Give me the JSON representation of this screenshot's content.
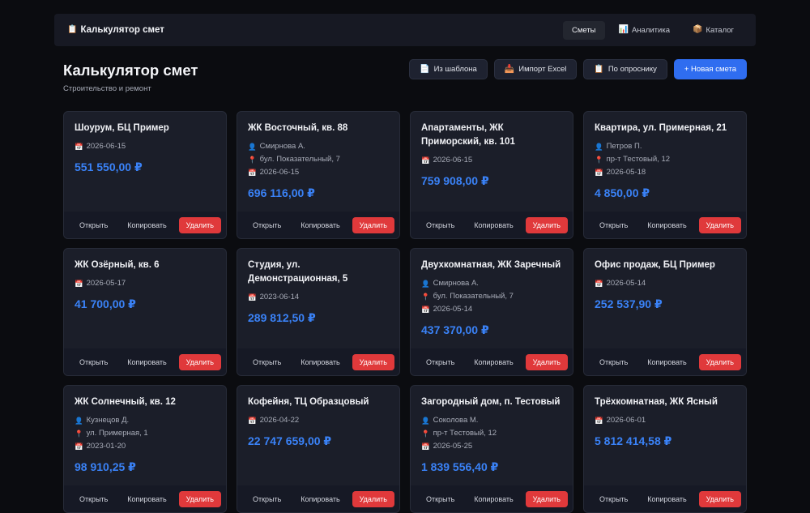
{
  "navbar": {
    "brand_icon": "📋",
    "brand": "Калькулятор смет",
    "tabs": [
      {
        "icon": "",
        "label": "Сметы",
        "active": true
      },
      {
        "icon": "📊",
        "label": "Аналитика",
        "active": false
      },
      {
        "icon": "📦",
        "label": "Каталог",
        "active": false
      }
    ]
  },
  "header": {
    "title": "Калькулятор смет",
    "subtitle": "Строительство и ремонт"
  },
  "actions": {
    "from_template": {
      "icon": "📄",
      "label": "Из шаблона"
    },
    "import_excel": {
      "icon": "📥",
      "label": "Импорт Excel"
    },
    "by_survey": {
      "icon": "📋",
      "label": "По опроснику"
    },
    "new_estimate": {
      "label": "+ Новая смета"
    }
  },
  "card_buttons": {
    "open": "Открыть",
    "copy": "Копировать",
    "delete": "Удалить"
  },
  "meta_icons": {
    "client": "👤",
    "address": "📍",
    "date": "📅"
  },
  "cards": [
    {
      "title": "Шоурум, БЦ Пример",
      "client": "",
      "address": "",
      "date": "2026-06-15",
      "price": "551 550,00 ₽"
    },
    {
      "title": "ЖК Восточный, кв. 88",
      "client": "Смирнова А.",
      "address": "бул. Показательный, 7",
      "date": "2026-06-15",
      "price": "696 116,00 ₽"
    },
    {
      "title": "Апартаменты, ЖК Приморский, кв. 101",
      "client": "",
      "address": "",
      "date": "2026-06-15",
      "price": "759 908,00 ₽"
    },
    {
      "title": "Квартира, ул. Примерная, 21",
      "client": "Петров П.",
      "address": "пр-т Тестовый, 12",
      "date": "2026-05-18",
      "price": "4 850,00 ₽"
    },
    {
      "title": "ЖК Озёрный, кв. 6",
      "client": "",
      "address": "",
      "date": "2026-05-17",
      "price": "41 700,00 ₽"
    },
    {
      "title": "Студия, ул. Демонстрационная, 5",
      "client": "",
      "address": "",
      "date": "2023-06-14",
      "price": "289 812,50 ₽"
    },
    {
      "title": "Двухкомнатная, ЖК Заречный",
      "client": "Смирнова А.",
      "address": "бул. Показательный, 7",
      "date": "2026-05-14",
      "price": "437 370,00 ₽"
    },
    {
      "title": "Офис продаж, БЦ Пример",
      "client": "",
      "address": "",
      "date": "2026-05-14",
      "price": "252 537,90 ₽"
    },
    {
      "title": "ЖК Солнечный, кв. 12",
      "client": "Кузнецов Д.",
      "address": "ул. Примерная, 1",
      "date": "2023-01-20",
      "price": "98 910,25 ₽"
    },
    {
      "title": "Кофейня, ТЦ Образцовый",
      "client": "",
      "address": "",
      "date": "2026-04-22",
      "price": "22 747 659,00 ₽"
    },
    {
      "title": "Загородный дом, п. Тестовый",
      "client": "Соколова М.",
      "address": "пр-т Тестовый, 12",
      "date": "2026-05-25",
      "price": "1 839 556,40 ₽"
    },
    {
      "title": "Трёхкомнатная, ЖК Ясный",
      "client": "",
      "address": "",
      "date": "2026-06-01",
      "price": "5 812 414,58 ₽"
    }
  ]
}
